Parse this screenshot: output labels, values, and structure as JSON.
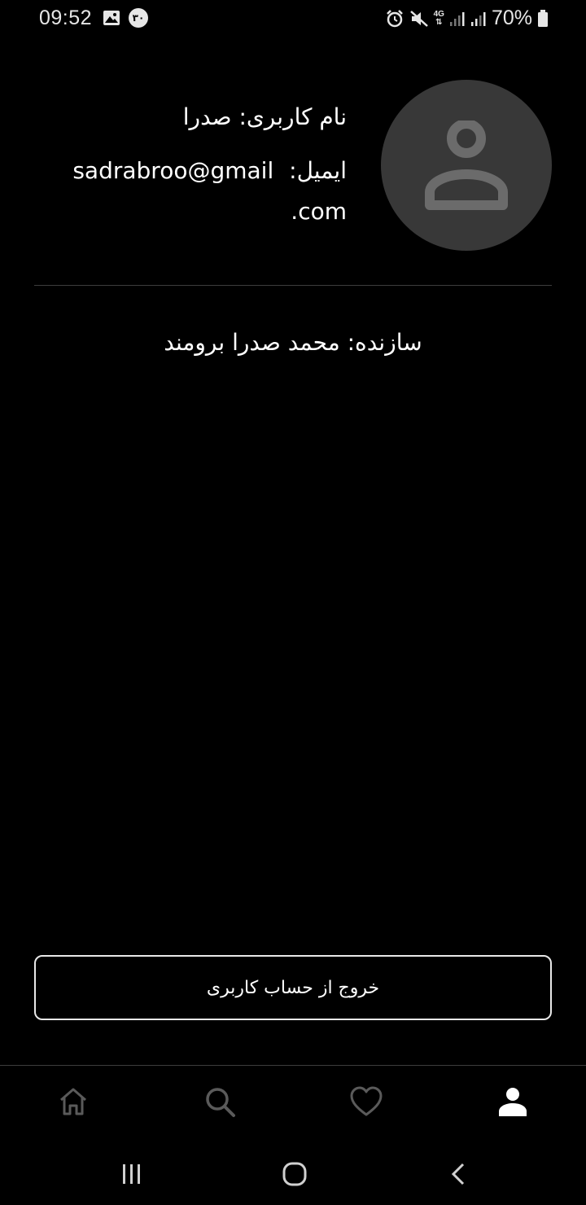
{
  "status_bar": {
    "time": "09:52",
    "notification_badge": "۳۰",
    "network": "4G",
    "battery": "70%",
    "icons": [
      "gallery-icon",
      "badge-icon",
      "alarm-icon",
      "mute-icon",
      "network-4g-icon",
      "signal-icon",
      "signal-icon",
      "battery-icon"
    ]
  },
  "profile": {
    "username_line": "نام کاربری: صدرا",
    "email_label": "ایمیل:",
    "email_part1": "sadrabroo@gmail",
    "email_part2": ".com",
    "avatar_icon": "user-avatar-icon"
  },
  "creator_line": "سازنده: محمد صدرا برومند",
  "logout_label": "خروج از حساب کاربری",
  "bottom_nav": {
    "items": [
      {
        "icon": "home-icon",
        "active": false
      },
      {
        "icon": "search-icon",
        "active": false
      },
      {
        "icon": "heart-icon",
        "active": false
      },
      {
        "icon": "profile-icon",
        "active": true
      }
    ]
  },
  "system_nav": {
    "items": [
      "recent-apps-icon",
      "home-circle-icon",
      "back-icon"
    ]
  },
  "colors": {
    "background": "#000000",
    "avatar_bg": "#383838",
    "avatar_fg": "#6b6b6b",
    "inactive_icon": "#5a5a5a",
    "active_icon": "#ffffff"
  }
}
